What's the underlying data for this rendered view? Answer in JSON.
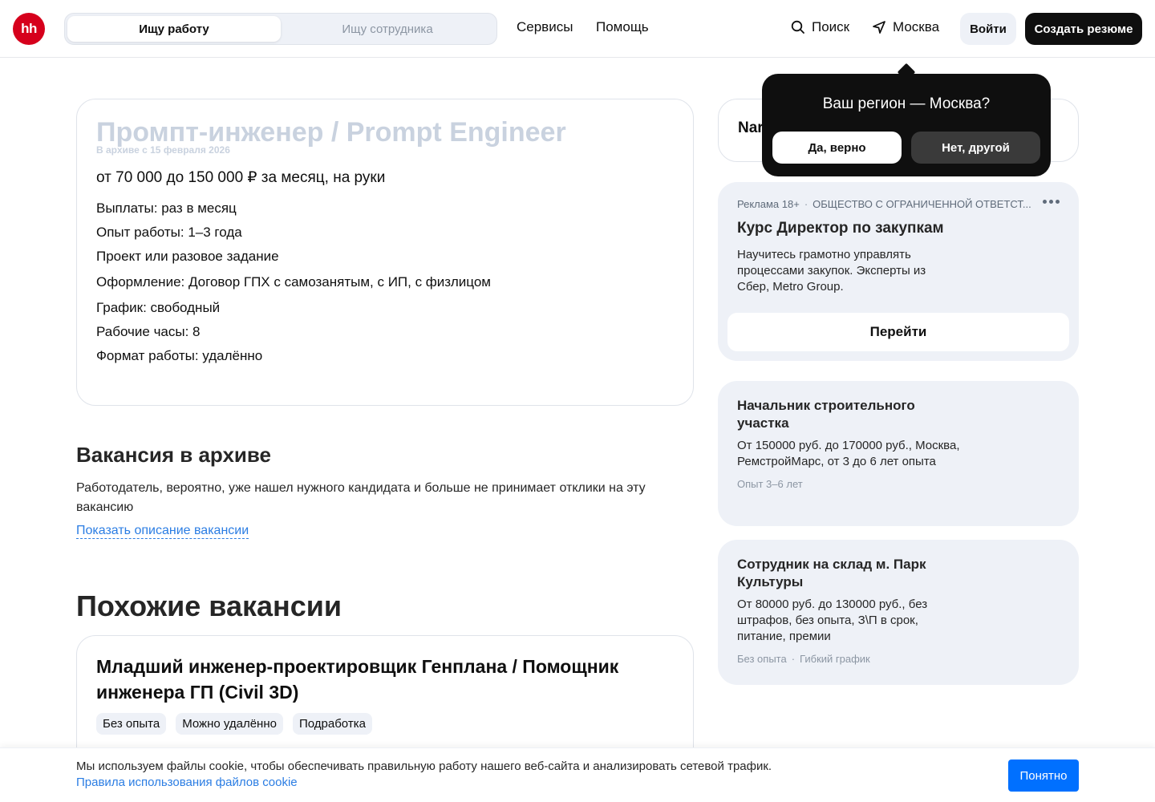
{
  "header": {
    "logo_text": "hh",
    "tabs": [
      {
        "label": "Ищу работу",
        "active": true
      },
      {
        "label": "Ищу сотрудника",
        "active": false
      }
    ],
    "nav": {
      "services": "Сервисы",
      "help": "Помощь",
      "search": "Поиск",
      "city": "Москва"
    },
    "login": "Войти",
    "create_resume": "Создать резюме"
  },
  "vacancy": {
    "title": "Промпт-инженер / Prompt Engineer",
    "archived_note": "В архиве с 15 февраля 2026",
    "salary": "от 70 000 до 150 000 ₽ за месяц, на руки",
    "details": [
      "Выплаты: раз в месяц",
      "Опыт работы: 1–3 года",
      "Проект или разовое задание",
      "Оформление: Договор ГПХ с самозанятым, с ИП, с физлицом",
      "График: свободный",
      "Рабочие часы: 8",
      "Формат работы: удалённо"
    ]
  },
  "archive": {
    "heading": "Вакансия в архиве",
    "text": "Работодатель, вероятно, уже нашел нужного кандидата и больше не принимает отклики на эту вакансию",
    "link": "Показать описание вакансии"
  },
  "similar": {
    "heading": "Похожие вакансии",
    "card": {
      "title": "Младший инженер-проектировщик Генплана / Помощник инженера ГП (Civil 3D)",
      "chips": [
        "Без опыта",
        "Можно удалённо",
        "Подработка"
      ]
    }
  },
  "employer_card": {
    "name_visible": "Nar"
  },
  "region_popup": {
    "question": "Ваш регион — Москва?",
    "yes": "Да, верно",
    "no": "Нет, другой"
  },
  "ad": {
    "label": "Реклама 18+",
    "company": "ОБЩЕСТВО С ОГРАНИЧЕННОЙ ОТВЕТСТ...",
    "title": "Курс Директор по закупкам",
    "text": "Научитесь грамотно управлять процессами закупок. Эксперты из Сбер, Metro Group.",
    "button": "Перейти"
  },
  "jobs": [
    {
      "title": "Начальник строительного участка",
      "text": "От 150000 руб. до 170000 руб., Москва, РемстройМарс, от 3 до 6 лет опыта",
      "meta": [
        "Опыт 3–6 лет"
      ]
    },
    {
      "title": "Сотрудник на склад м. Парк Культуры",
      "text": "От 80000 руб. до 130000 руб., без штрафов, без опыта, З\\П в срок, питание, премии",
      "meta": [
        "Без опыта",
        "·",
        "Гибкий график"
      ]
    }
  ],
  "cookie": {
    "text": "Мы используем файлы cookie, чтобы обеспечивать правильную работу нашего веб-сайта и анализировать сетевой трафик.",
    "link": "Правила использования файлов cookie",
    "button": "Понятно"
  },
  "colors": {
    "brand": "#d6001c",
    "link": "#2b7de3",
    "primary_button": "#0070ff",
    "dark": "#0f0f0f",
    "card_bg": "#eef1f7"
  }
}
